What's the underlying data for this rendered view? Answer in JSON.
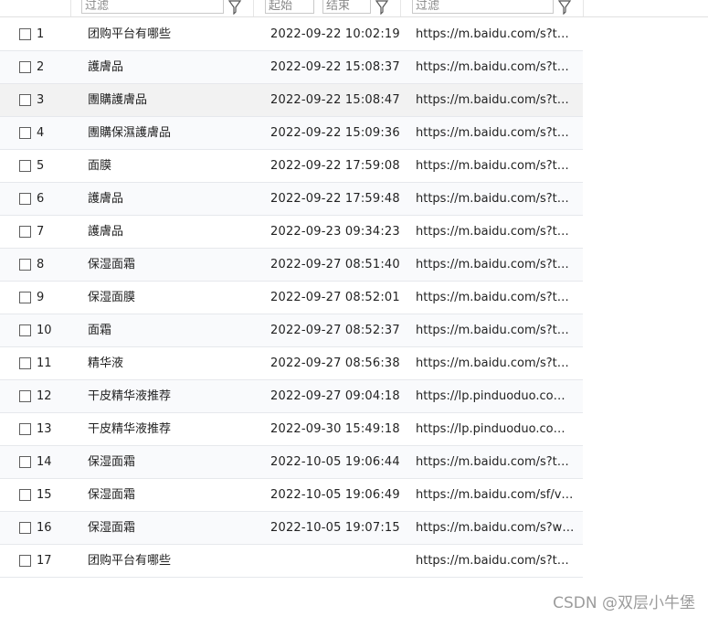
{
  "filters": {
    "keyword_placeholder": "过滤",
    "time_start_placeholder": "起始",
    "time_end_placeholder": "结束",
    "url_placeholder": "过滤"
  },
  "rows": [
    {
      "index": "1",
      "keyword": "团购平台有哪些",
      "time": "2022-09-22 10:02:19",
      "url": "https://m.baidu.com/s?tn=..."
    },
    {
      "index": "2",
      "keyword": "護膚品",
      "time": "2022-09-22 15:08:37",
      "url": "https://m.baidu.com/s?tn=..."
    },
    {
      "index": "3",
      "keyword": "團購護膚品",
      "time": "2022-09-22 15:08:47",
      "url": "https://m.baidu.com/s?tn=..."
    },
    {
      "index": "4",
      "keyword": "團購保濕護膚品",
      "time": "2022-09-22 15:09:36",
      "url": "https://m.baidu.com/s?tn=..."
    },
    {
      "index": "5",
      "keyword": "面膜",
      "time": "2022-09-22 17:59:08",
      "url": "https://m.baidu.com/s?tn=..."
    },
    {
      "index": "6",
      "keyword": "護膚品",
      "time": "2022-09-22 17:59:48",
      "url": "https://m.baidu.com/s?tn=..."
    },
    {
      "index": "7",
      "keyword": "護膚品",
      "time": "2022-09-23 09:34:23",
      "url": "https://m.baidu.com/s?tn=..."
    },
    {
      "index": "8",
      "keyword": "保湿面霜",
      "time": "2022-09-27 08:51:40",
      "url": "https://m.baidu.com/s?tn=..."
    },
    {
      "index": "9",
      "keyword": "保湿面膜",
      "time": "2022-09-27 08:52:01",
      "url": "https://m.baidu.com/s?tn=..."
    },
    {
      "index": "10",
      "keyword": "面霜",
      "time": "2022-09-27 08:52:37",
      "url": "https://m.baidu.com/s?tn=..."
    },
    {
      "index": "11",
      "keyword": "精华液",
      "time": "2022-09-27 08:56:38",
      "url": "https://m.baidu.com/s?tn=..."
    },
    {
      "index": "12",
      "keyword": "干皮精华液推荐",
      "time": "2022-09-27 09:04:18",
      "url": "https://lp.pinduoduo.com/..."
    },
    {
      "index": "13",
      "keyword": "干皮精华液推荐",
      "time": "2022-09-30 15:49:18",
      "url": "https://lp.pinduoduo.com/..."
    },
    {
      "index": "14",
      "keyword": "保湿面霜",
      "time": "2022-10-05 19:06:44",
      "url": "https://m.baidu.com/s?tn=..."
    },
    {
      "index": "15",
      "keyword": "保湿面霜",
      "time": "2022-10-05 19:06:49",
      "url": "https://m.baidu.com/sf/vse..."
    },
    {
      "index": "16",
      "keyword": "保湿面霜",
      "time": "2022-10-05 19:07:15",
      "url": "https://m.baidu.com/s?wor..."
    },
    {
      "index": "17",
      "keyword": "团购平台有哪些",
      "time": "",
      "url": "https://m.baidu.com/s?tn=..."
    }
  ],
  "watermark": "CSDN @双层小牛堡",
  "icons": {
    "filter": "funnel-icon",
    "checkbox": "checkbox"
  }
}
